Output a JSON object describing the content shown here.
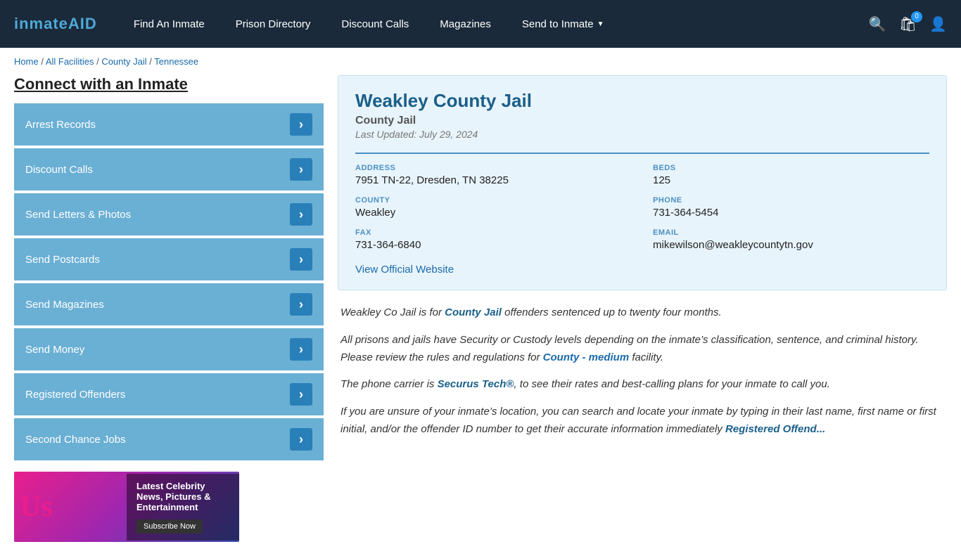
{
  "header": {
    "logo": "inmateAID",
    "logo_part1": "inmate",
    "logo_part2": "AID",
    "nav": [
      {
        "label": "Find An Inmate",
        "id": "find-inmate"
      },
      {
        "label": "Prison Directory",
        "id": "prison-directory"
      },
      {
        "label": "Discount Calls",
        "id": "discount-calls"
      },
      {
        "label": "Magazines",
        "id": "magazines"
      },
      {
        "label": "Send to Inmate",
        "id": "send-to-inmate",
        "hasDropdown": true
      }
    ],
    "cart_count": "0",
    "icons": {
      "search": "🔍",
      "cart": "🛒",
      "user": "👤"
    }
  },
  "breadcrumb": {
    "items": [
      {
        "label": "Home",
        "href": "#"
      },
      {
        "label": "All Facilities",
        "href": "#"
      },
      {
        "label": "County Jail",
        "href": "#"
      },
      {
        "label": "Tennessee",
        "href": "#"
      }
    ]
  },
  "sidebar": {
    "title": "Connect with an Inmate",
    "menu": [
      {
        "label": "Arrest Records",
        "id": "arrest-records"
      },
      {
        "label": "Discount Calls",
        "id": "discount-calls"
      },
      {
        "label": "Send Letters & Photos",
        "id": "send-letters"
      },
      {
        "label": "Send Postcards",
        "id": "send-postcards"
      },
      {
        "label": "Send Magazines",
        "id": "send-magazines"
      },
      {
        "label": "Send Money",
        "id": "send-money"
      },
      {
        "label": "Registered Offenders",
        "id": "registered-offenders"
      },
      {
        "label": "Second Chance Jobs",
        "id": "second-chance-jobs"
      }
    ],
    "ad": {
      "title": "Latest Celebrity News, Pictures & Entertainment",
      "subscribe_label": "Subscribe Now"
    }
  },
  "facility": {
    "name": "Weakley County Jail",
    "type": "County Jail",
    "last_updated": "Last Updated: July 29, 2024",
    "address_label": "ADDRESS",
    "address_value": "7951 TN-22, Dresden, TN 38225",
    "beds_label": "BEDS",
    "beds_value": "125",
    "county_label": "COUNTY",
    "county_value": "Weakley",
    "phone_label": "PHONE",
    "phone_value": "731-364-5454",
    "fax_label": "FAX",
    "fax_value": "731-364-6840",
    "email_label": "EMAIL",
    "email_value": "mikewilson@weakleycountytn.gov",
    "website_link": "View Official Website"
  },
  "description": {
    "para1_prefix": "Weakley Co Jail is for ",
    "para1_link": "County Jail",
    "para1_suffix": " offenders sentenced up to twenty four months.",
    "para2_prefix": "All prisons and jails have Security or Custody levels depending on the inmate’s classification, sentence, and criminal history. Please review the rules and regulations for ",
    "para2_link": "County - medium",
    "para2_suffix": " facility.",
    "para3_prefix": "The phone carrier is ",
    "para3_link": "Securus Tech®",
    "para3_suffix": ", to see their rates and best-calling plans for your inmate to call you.",
    "para4_prefix": "If you are unsure of your inmate’s location, you can search and locate your inmate by typing in their last name, first name or first initial, and/or the offender ID number to get their accurate information immediately",
    "para4_link": "Registered Offend..."
  }
}
